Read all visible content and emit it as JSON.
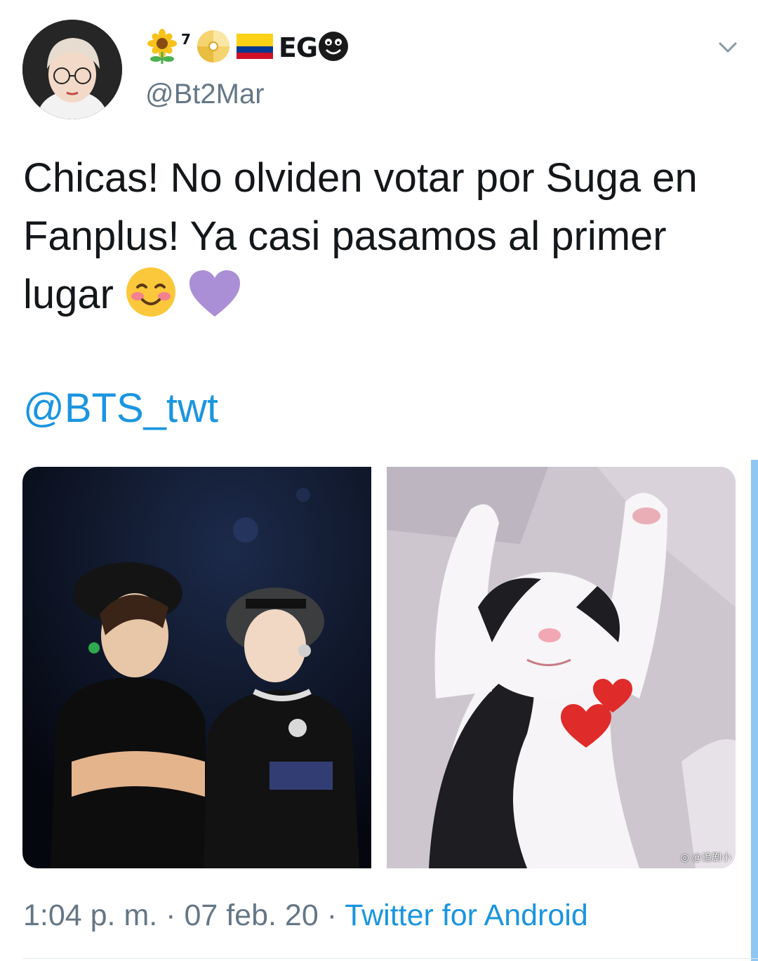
{
  "user": {
    "display_name_prefix_icon": "sunflower-icon",
    "superscript": "7",
    "display_name_icons": [
      "cd-icon",
      "colombia-flag-icon"
    ],
    "display_name": "EG",
    "display_name_suffix_icon": "smiling-face-icon",
    "handle": "@Bt2Mar"
  },
  "tweet": {
    "text": "Chicas! No olviden votar por Suga en Fanplus! Ya casi pasamos al primer lugar",
    "emojis": [
      "smiling-face-with-blush-icon",
      "purple-heart-icon"
    ],
    "mention": "@BTS_twt"
  },
  "media": {
    "left_description_icon": "photo-two-performers",
    "right_description_icon": "photo-cat-with-hearts",
    "watermark": "@追剧小"
  },
  "footer": {
    "time": "1:04 p. m.",
    "separator": "·",
    "date": "07 feb. 20",
    "source": "Twitter for Android"
  },
  "colors": {
    "link": "#1b95e0",
    "secondary": "#657786",
    "text": "#14171a"
  }
}
